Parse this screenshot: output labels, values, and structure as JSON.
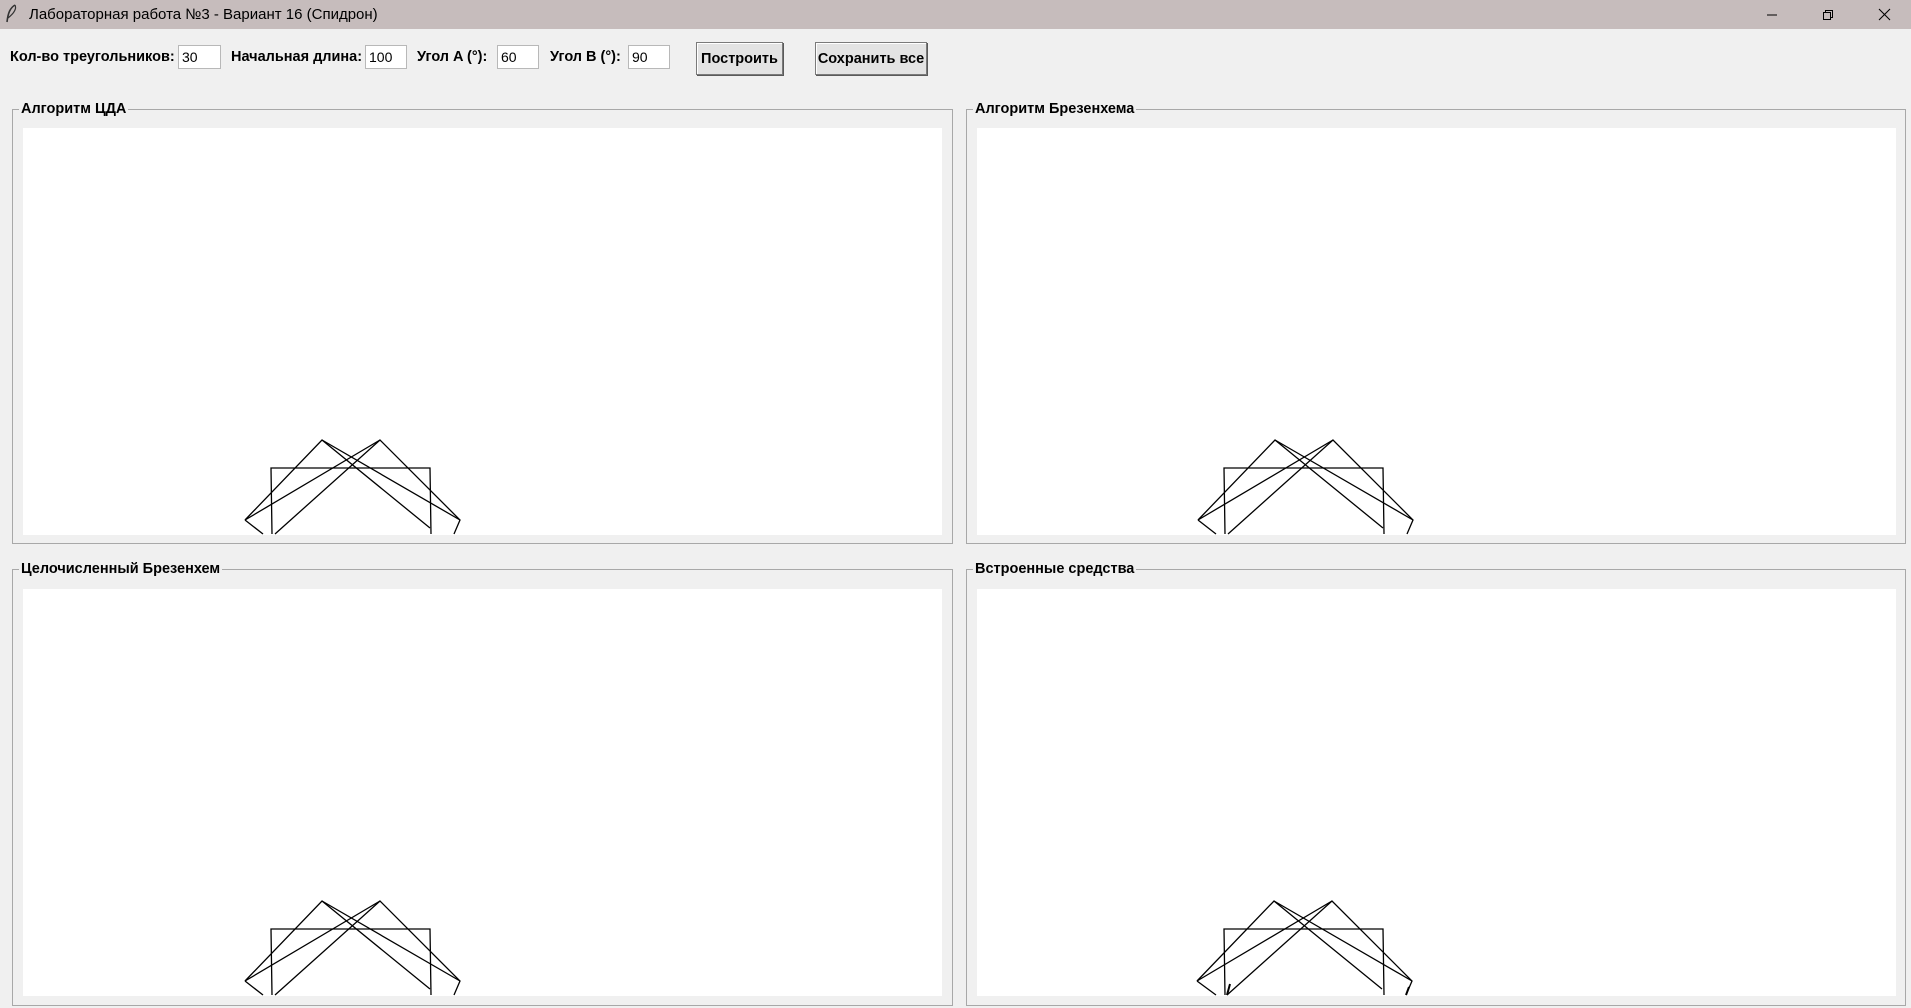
{
  "window": {
    "title": "Лабораторная работа №3 - Вариант 16 (Спидрон)"
  },
  "toolbar": {
    "count_label": "Кол-во треугольников:",
    "count_value": "30",
    "length_label": "Начальная длина:",
    "length_value": "100",
    "angle_a_label": "Угол A (°):",
    "angle_a_value": "60",
    "angle_b_label": "Угол B (°):",
    "angle_b_value": "90",
    "build_button": "Построить",
    "save_all_button": "Сохранить все"
  },
  "panels": [
    {
      "title": "Алгоритм ЦДА"
    },
    {
      "title": "Алгоритм Брезенхема"
    },
    {
      "title": "Целочисленный Брезенхем"
    },
    {
      "title": "Встроенные средства"
    }
  ],
  "icons": {
    "app": "feather-icon",
    "minimize": "minimize-icon",
    "maximize": "restore-icon",
    "close": "close-icon"
  },
  "colors": {
    "titlebar": "#c6bcbc",
    "window_bg": "#f0f0f0",
    "canvas_bg": "#ffffff",
    "drawing": "#000000"
  }
}
